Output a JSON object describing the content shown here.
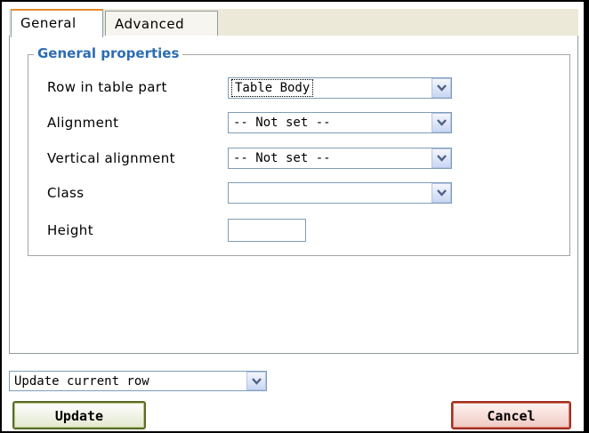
{
  "tabs": {
    "general": "General",
    "advanced": "Advanced"
  },
  "fieldset": {
    "legend": "General properties",
    "rows": {
      "row_in_table_part": {
        "label": "Row in table part",
        "value": "Table Body"
      },
      "alignment": {
        "label": "Alignment",
        "value": "-- Not set --"
      },
      "vertical_alignment": {
        "label": "Vertical alignment",
        "value": "-- Not set --"
      },
      "class": {
        "label": "Class",
        "value": ""
      },
      "height": {
        "label": "Height",
        "value": ""
      }
    }
  },
  "footer": {
    "scope_select": "Update current row",
    "update_button": "Update",
    "cancel_button": "Cancel"
  },
  "icons": {
    "dropdown": "chevron-down-icon"
  },
  "colors": {
    "legend": "#2b6cb3",
    "active_tab_top": "#e68b2c",
    "update_border": "#5a6a2b",
    "cancel_border": "#a02f20"
  }
}
